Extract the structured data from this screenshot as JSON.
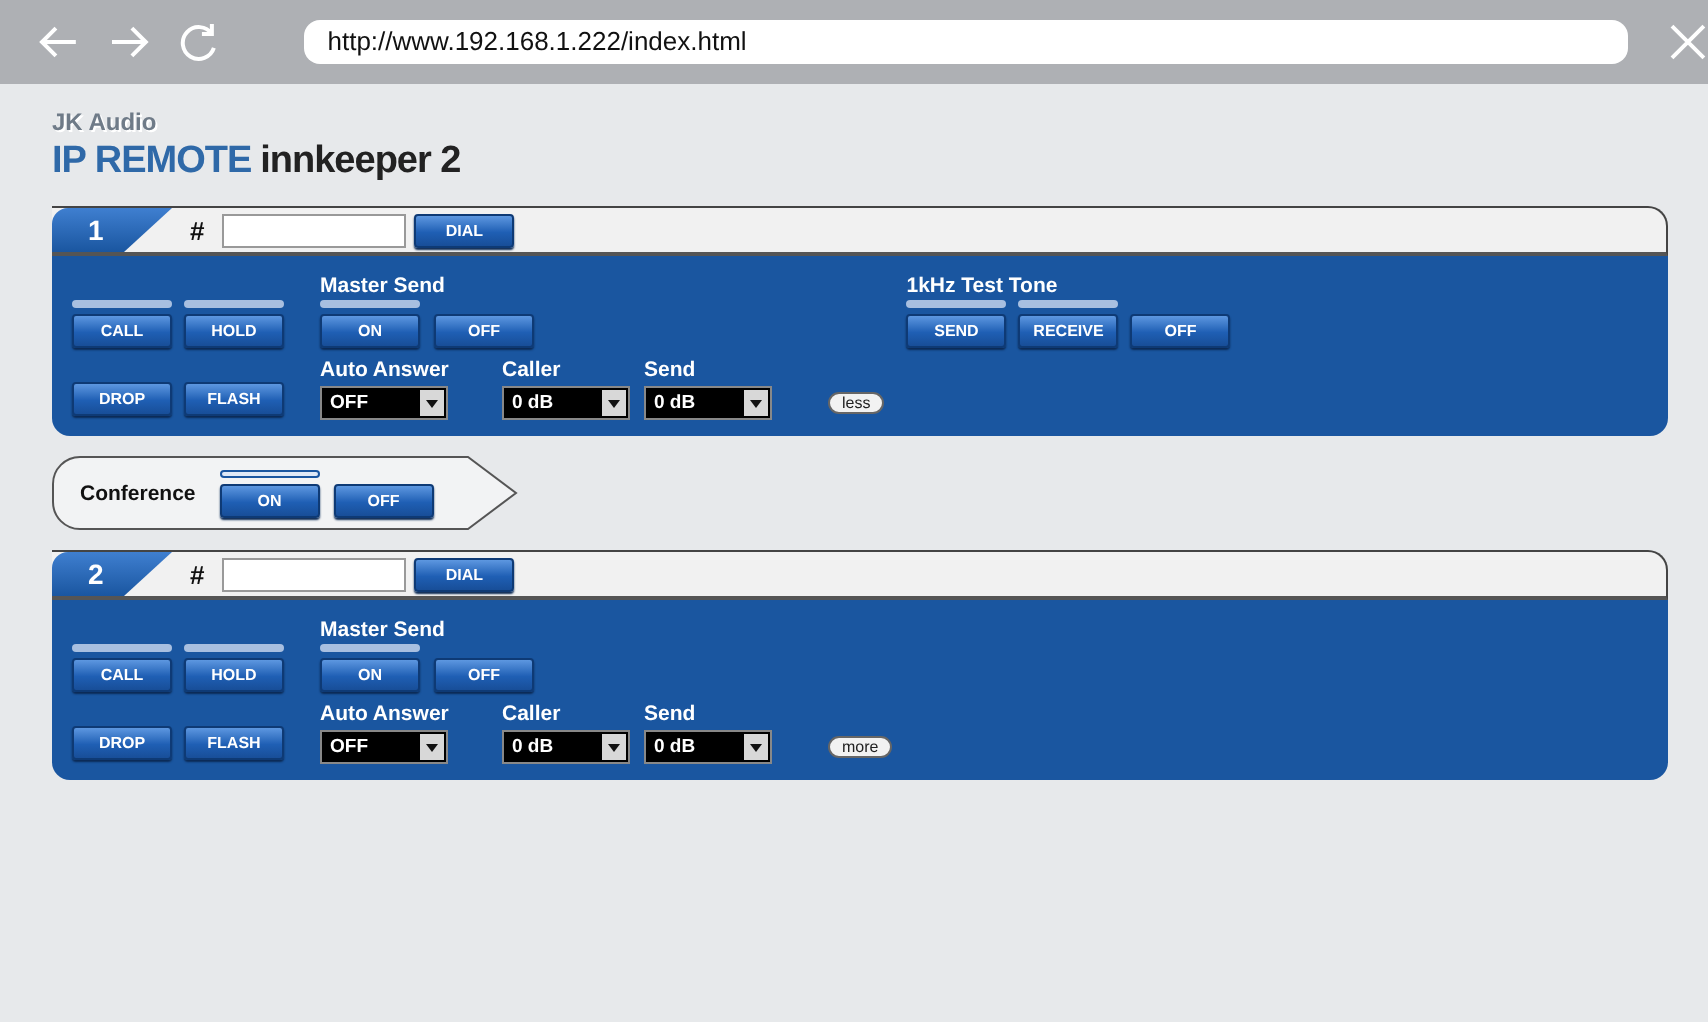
{
  "browser": {
    "url": "http://www.192.168.1.222/index.html"
  },
  "logo": {
    "brand": "JK Audio",
    "product": "IP REMOTE",
    "model": "innkeeper 2"
  },
  "sections": [
    {
      "kind": "line",
      "number": "1",
      "number_sign": "#",
      "dial_button": "DIAL",
      "call_buttons": [
        {
          "label": "CALL",
          "indicator": true,
          "lit": false
        },
        {
          "label": "HOLD",
          "indicator": true,
          "lit": false
        },
        {
          "label": "DROP",
          "indicator": false
        },
        {
          "label": "FLASH",
          "indicator": false
        }
      ],
      "master_send": {
        "label": "Master Send",
        "buttons": [
          {
            "label": "ON",
            "indicator": true,
            "lit": false
          },
          {
            "label": "OFF",
            "indicator": false
          }
        ]
      },
      "settings": [
        {
          "label": "Auto Answer",
          "value": "OFF"
        },
        {
          "label": "Caller",
          "value": "0 dB"
        },
        {
          "label": "Send",
          "value": "0 dB"
        }
      ],
      "toggle": "less",
      "test_tone": {
        "label": "1kHz Test Tone",
        "buttons": [
          {
            "label": "SEND",
            "indicator": true,
            "lit": false
          },
          {
            "label": "RECEIVE",
            "indicator": true,
            "lit": false
          },
          {
            "label": "OFF",
            "indicator": false
          }
        ]
      }
    },
    {
      "kind": "conference",
      "label": "Conference",
      "buttons": [
        {
          "label": "ON",
          "indicator": true,
          "lit": true
        },
        {
          "label": "OFF",
          "indicator": false
        }
      ]
    },
    {
      "kind": "line",
      "number": "2",
      "number_sign": "#",
      "dial_button": "DIAL",
      "call_buttons": [
        {
          "label": "CALL",
          "indicator": true,
          "lit": false
        },
        {
          "label": "HOLD",
          "indicator": true,
          "lit": false
        },
        {
          "label": "DROP",
          "indicator": false
        },
        {
          "label": "FLASH",
          "indicator": false
        }
      ],
      "master_send": {
        "label": "Master Send",
        "buttons": [
          {
            "label": "ON",
            "indicator": true,
            "lit": false
          },
          {
            "label": "OFF",
            "indicator": false
          }
        ]
      },
      "settings": [
        {
          "label": "Auto Answer",
          "value": "OFF"
        },
        {
          "label": "Caller",
          "value": "0 dB"
        },
        {
          "label": "Send",
          "value": "0 dB"
        }
      ],
      "toggle": "more"
    }
  ]
}
